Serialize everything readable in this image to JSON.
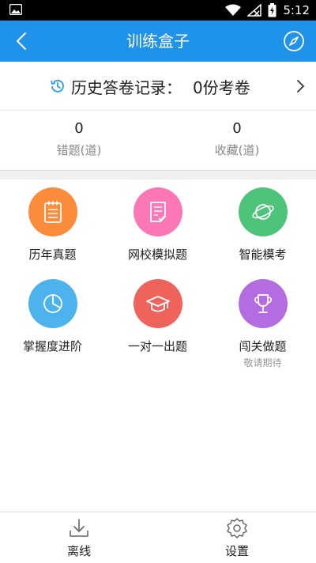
{
  "status_bar": {
    "time": "5:12"
  },
  "app_bar": {
    "title": "训练盒子"
  },
  "history": {
    "label": "历史答卷记录：",
    "count": "0份考卷"
  },
  "stats": [
    {
      "value": "0",
      "caption": "错题(道)"
    },
    {
      "value": "0",
      "caption": "收藏(道)"
    }
  ],
  "tiles": [
    {
      "label": "历年真题",
      "subtitle": "",
      "color": "#fb8c3c",
      "icon": "notebook-icon"
    },
    {
      "label": "网校模拟题",
      "subtitle": "",
      "color": "#fb77b5",
      "icon": "checklist-icon"
    },
    {
      "label": "智能模考",
      "subtitle": "",
      "color": "#4ec47a",
      "icon": "planet-icon"
    },
    {
      "label": "掌握度进阶",
      "subtitle": "",
      "color": "#4cb3ed",
      "icon": "pie-chart-icon"
    },
    {
      "label": "一对一出题",
      "subtitle": "",
      "color": "#f0635c",
      "icon": "graduation-cap-icon"
    },
    {
      "label": "闯关做题",
      "subtitle": "敬请期待",
      "color": "#b46de0",
      "icon": "trophy-icon"
    }
  ],
  "bottom_nav": [
    {
      "label": "离线",
      "icon": "download-icon"
    },
    {
      "label": "设置",
      "icon": "settings-gear-icon"
    }
  ],
  "colors": {
    "primary": "#1f93ea",
    "accent_clock": "#2b9cf0"
  }
}
